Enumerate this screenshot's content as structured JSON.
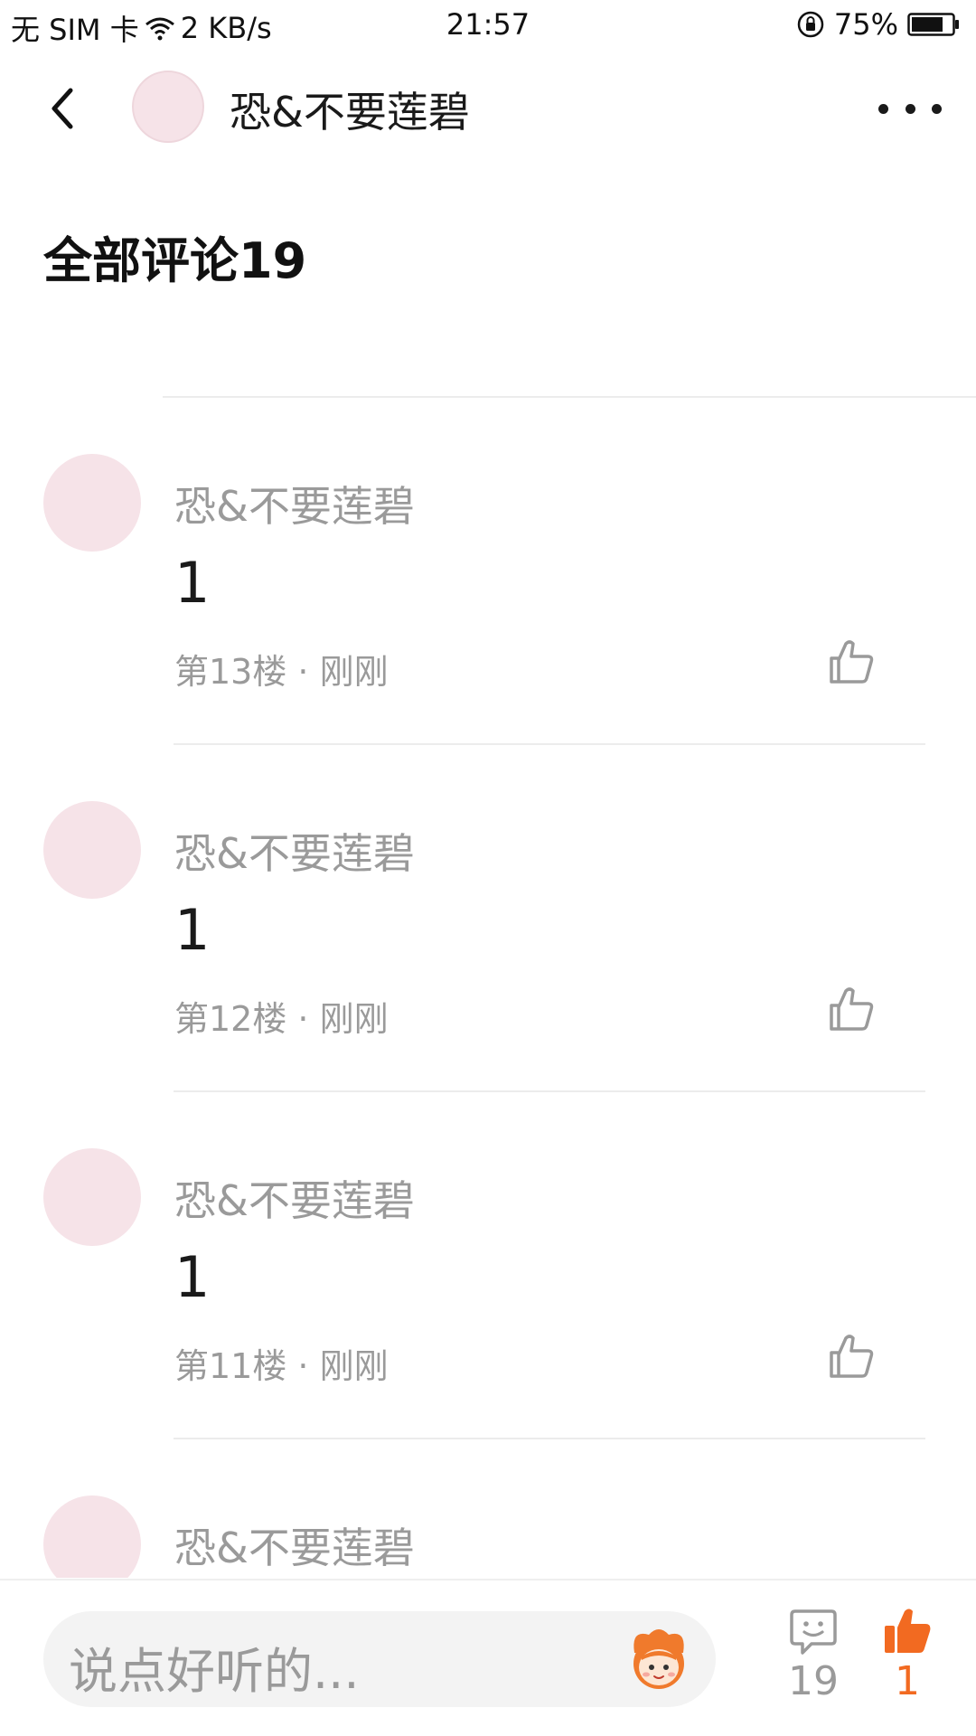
{
  "status_bar": {
    "sim": "无 SIM 卡",
    "speed": "2 KB/s",
    "time": "21:57",
    "battery": "75%"
  },
  "header": {
    "title": "恐&不要莲碧"
  },
  "section": {
    "title": "全部评论19"
  },
  "comments": [
    {
      "author": "恐&不要莲碧",
      "content": "1",
      "meta": "第13楼 · 刚刚"
    },
    {
      "author": "恐&不要莲碧",
      "content": "1",
      "meta": "第12楼 · 刚刚"
    },
    {
      "author": "恐&不要莲碧",
      "content": "1",
      "meta": "第11楼 · 刚刚"
    },
    {
      "author": "恐&不要莲碧",
      "content": "",
      "meta": ""
    }
  ],
  "bottom_bar": {
    "input_placeholder": "说点好听的...",
    "comment_count": "19",
    "like_count": "1"
  },
  "colors": {
    "accent_orange": "#f26a21",
    "avatar_placeholder": "#f6e3e8",
    "muted_text": "#9a9a9a"
  },
  "icons": {
    "back": "chevron-left-icon",
    "more": "more-dots-icon",
    "like": "thumbs-up-icon",
    "comment": "comment-bubble-icon",
    "emoji": "emoji-mascot-icon"
  }
}
